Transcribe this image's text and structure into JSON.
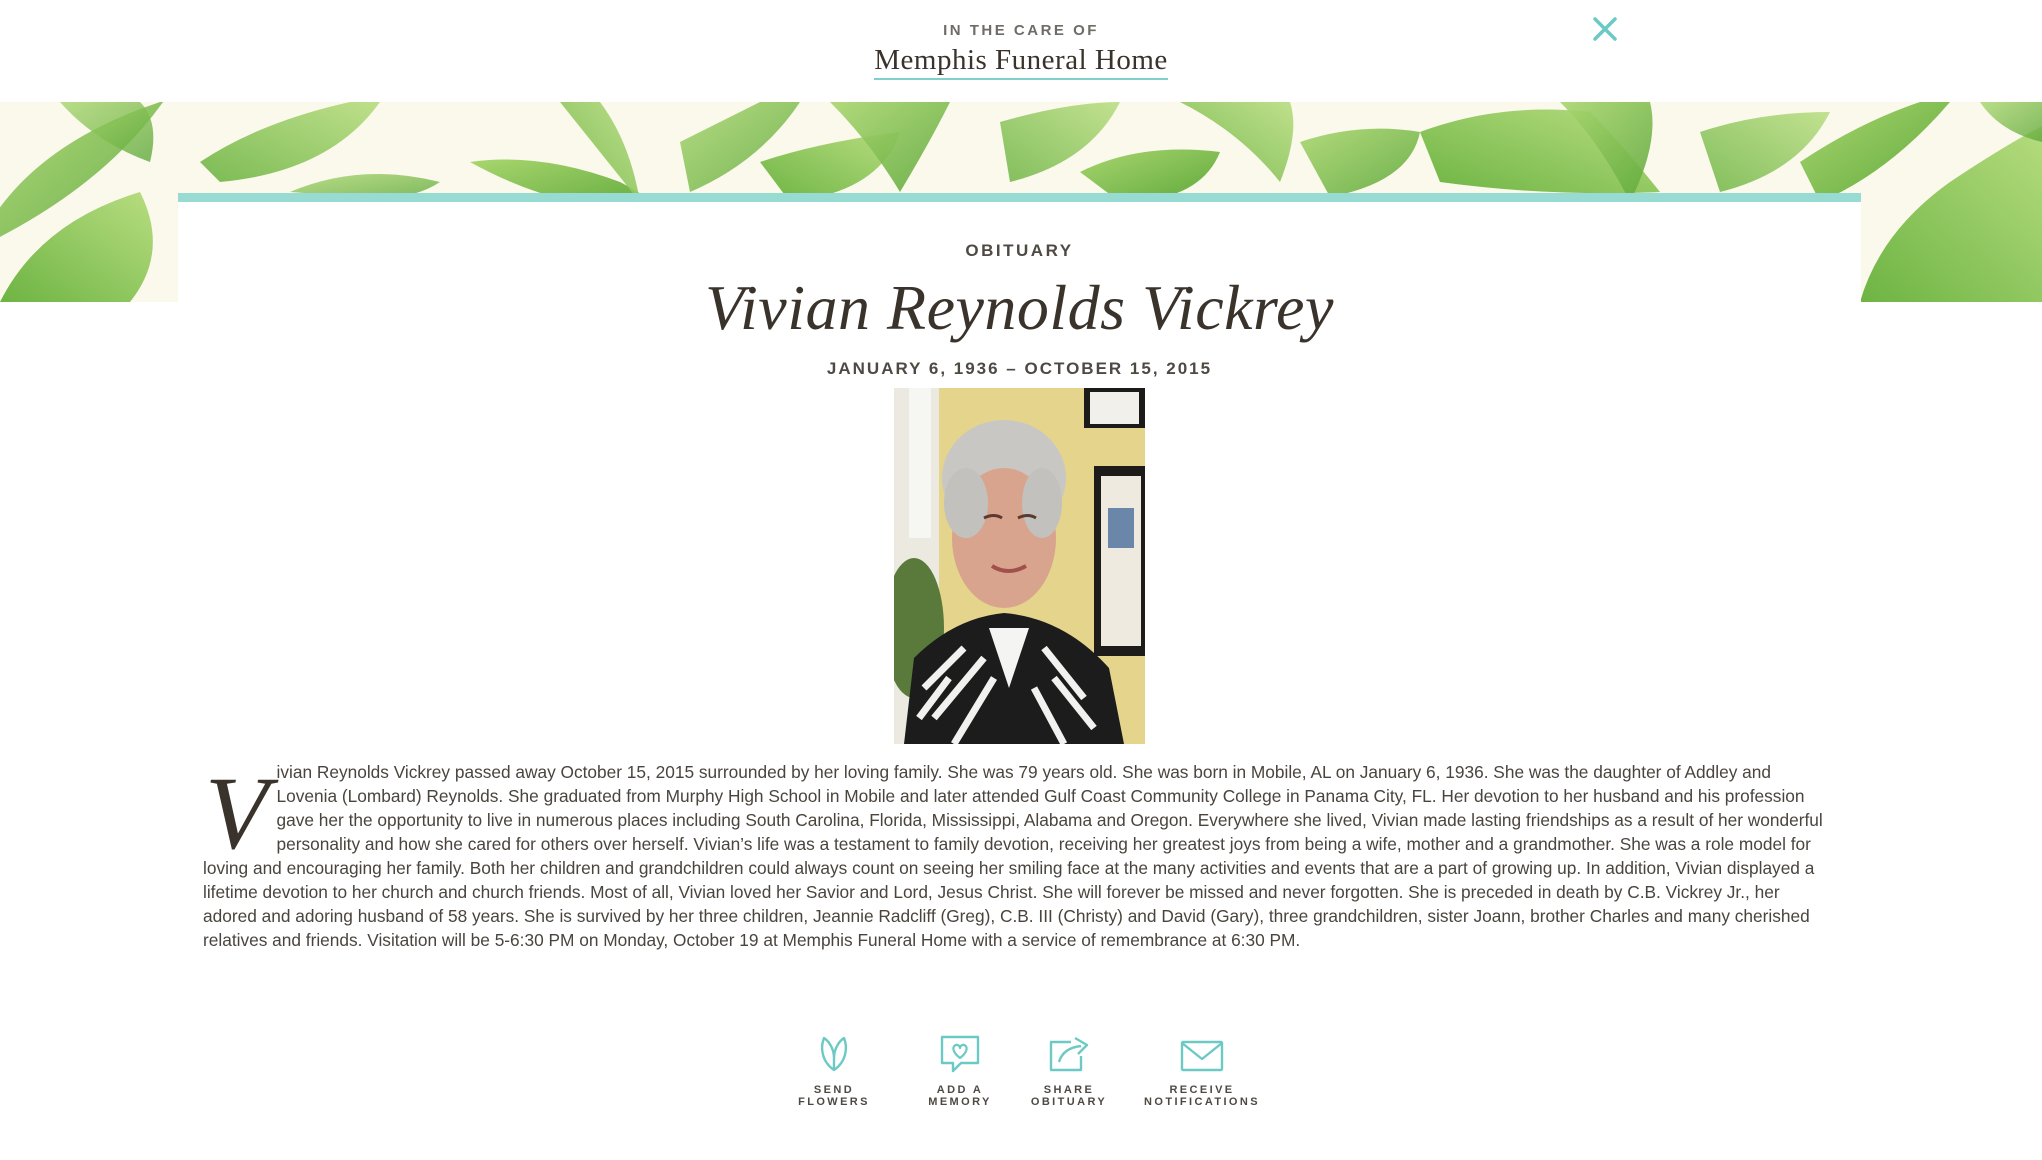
{
  "header": {
    "care_label": "IN THE CARE OF",
    "funeral_home": "Memphis Funeral Home",
    "close_icon": "close-icon",
    "accent_color": "#7fd0cd"
  },
  "obituary": {
    "section_label": "OBITUARY",
    "name": "Vivian Reynolds Vickrey",
    "dates": "JANUARY 6, 1936 – OCTOBER 15, 2015",
    "drop_cap": "V",
    "text": "ivian Reynolds Vickrey passed away October 15, 2015 surrounded by her loving family. She was 79 years old. She was born in Mobile, AL on January 6, 1936. She was the daughter of Addley and Lovenia (Lombard) Reynolds. She graduated from Murphy High School in Mobile and later attended Gulf Coast Community College in Panama City, FL. Her devotion to her husband and his profession gave her the opportunity to live in numerous places including South Carolina, Florida, Mississippi, Alabama and Oregon. Everywhere she lived, Vivian made lasting friendships as a result of her wonderful personality and how she cared for others over herself. Vivian’s life was a testament to family devotion, receiving her greatest joys from being a wife, mother and a grandmother. She was a role model for loving and encouraging her family. Both her children and grandchildren could always count on seeing her smiling face at the many activities and events that are a part of growing up. In addition, Vivian displayed a lifetime devotion to her church and church friends. Most of all, Vivian loved her Savior and Lord, Jesus Christ. She will forever be missed and never forgotten. She is preceded in death by C.B. Vickrey Jr., her adored and adoring husband of 58 years. She is survived by her three children, Jeannie Radcliff (Greg), C.B. III (Christy) and David (Gary), three grandchildren, sister Joann, brother Charles and many cherished relatives and friends. Visitation will be 5-6:30 PM on Monday, October 19 at Memphis Funeral Home with a service of remembrance at 6:30 PM."
  },
  "actions": [
    {
      "icon": "flowers-icon",
      "line1": "SEND FLOWERS",
      "line2": ""
    },
    {
      "icon": "memory-heart-icon",
      "line1": "ADD A",
      "line2": "MEMORY"
    },
    {
      "icon": "share-icon",
      "line1": "SHARE",
      "line2": "OBITUARY"
    },
    {
      "icon": "envelope-icon",
      "line1": "RECEIVE",
      "line2": "NOTIFICATIONS"
    }
  ],
  "colors": {
    "banner_background": "#fbf8ec",
    "card_top_border": "#97dbd2",
    "leaf_green": "#7cbf4a",
    "text_dark": "#3a332c"
  }
}
